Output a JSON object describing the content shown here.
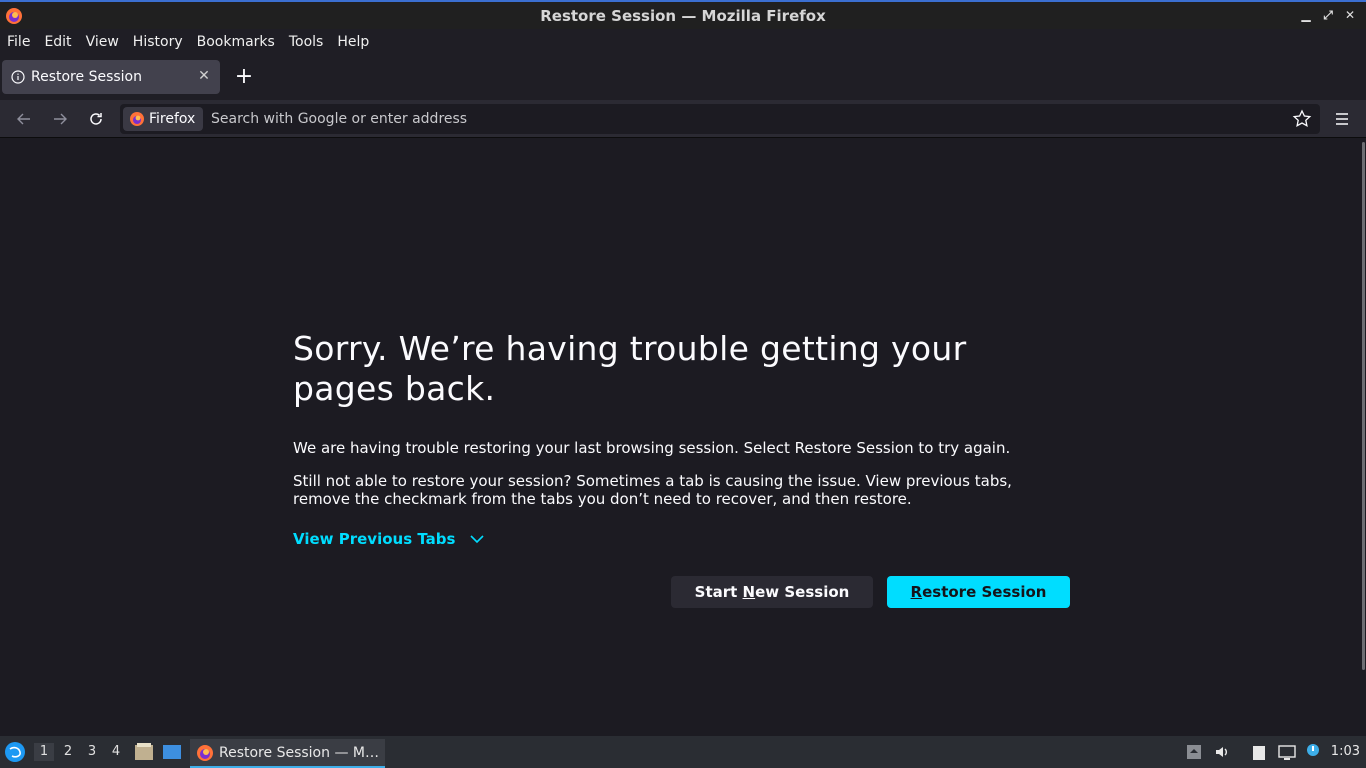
{
  "window": {
    "title": "Restore Session — Mozilla Firefox"
  },
  "menu": [
    "File",
    "Edit",
    "View",
    "History",
    "Bookmarks",
    "Tools",
    "Help"
  ],
  "tab": {
    "label": "Restore Session"
  },
  "urlbar": {
    "identity_label": "Firefox",
    "placeholder": "Search with Google or enter address"
  },
  "page": {
    "heading": "Sorry. We’re having trouble getting your pages back.",
    "para1": "We are having trouble restoring your last browsing session. Select Restore Session to try again.",
    "para2": "Still not able to restore your session? Sometimes a tab is causing the issue. View previous tabs, remove the checkmark from the tabs you don’t need to recover, and then restore.",
    "view_previous": "View Previous Tabs",
    "start_new_prefix": "Start ",
    "start_new_access": "N",
    "start_new_suffix": "ew Session",
    "restore_access": "R",
    "restore_suffix": "estore Session"
  },
  "taskbar": {
    "workspaces": [
      "1",
      "2",
      "3",
      "4"
    ],
    "task_label": "Restore Session — M…",
    "clock": "1:03"
  },
  "colors": {
    "accent": "#00ddff",
    "background": "#1c1b22",
    "toolbar": "#2b2a33"
  },
  "icons": [
    "firefox-icon",
    "info-icon",
    "close-icon",
    "plus-icon",
    "back-icon",
    "forward-icon",
    "reload-icon",
    "star-icon",
    "menu-icon",
    "chevron-down-icon"
  ]
}
